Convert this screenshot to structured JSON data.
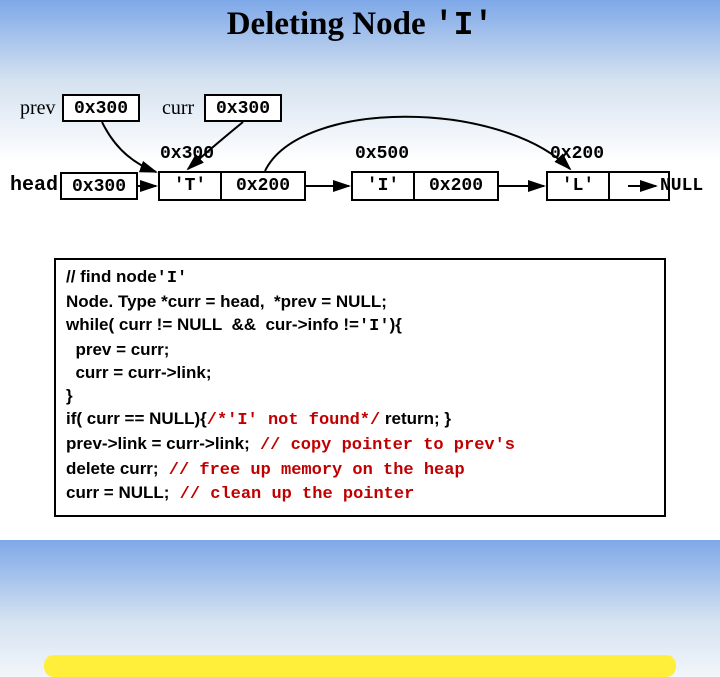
{
  "title_prefix": "Deleting Node",
  "title_code": "'I'",
  "labels": {
    "prev": "prev",
    "curr": "curr",
    "head": "head",
    "null": "NULL"
  },
  "boxes": {
    "prev_val": "0x300",
    "curr_val": "0x300",
    "head_val": "0x300"
  },
  "addrs": {
    "n1": "0x300",
    "n2": "0x500",
    "n3": "0x200"
  },
  "nodes": {
    "n1": {
      "info": "'T'",
      "link": "0x200"
    },
    "n2": {
      "info": "'I'",
      "link": "0x200"
    },
    "n3": {
      "info": "'L'",
      "link": "NULL"
    }
  },
  "code": {
    "l1_b": "// find node",
    "l1_m": "'I'",
    "l2_b": "Node. Type *curr = head,  *prev = NULL;",
    "l3_b": "while( curr != NULL  &&  cur->info !=",
    "l3_m": "'I'",
    "l3_end": "){",
    "l4_b": "  prev = curr;",
    "l5_b": "  curr = curr->link;",
    "l6_b": "}",
    "l7_b": "if( curr == NULL){",
    "l7_r": "/*'I' not found*/",
    "l7_end": " return; }",
    "l8_b": "prev->link = curr->link;",
    "l8_r": " // copy pointer to prev's",
    "l9_b": "delete curr;",
    "l9_r": " // free up memory on the heap",
    "l10_b": "curr = NULL;",
    "l10_r": " // clean up the pointer"
  }
}
